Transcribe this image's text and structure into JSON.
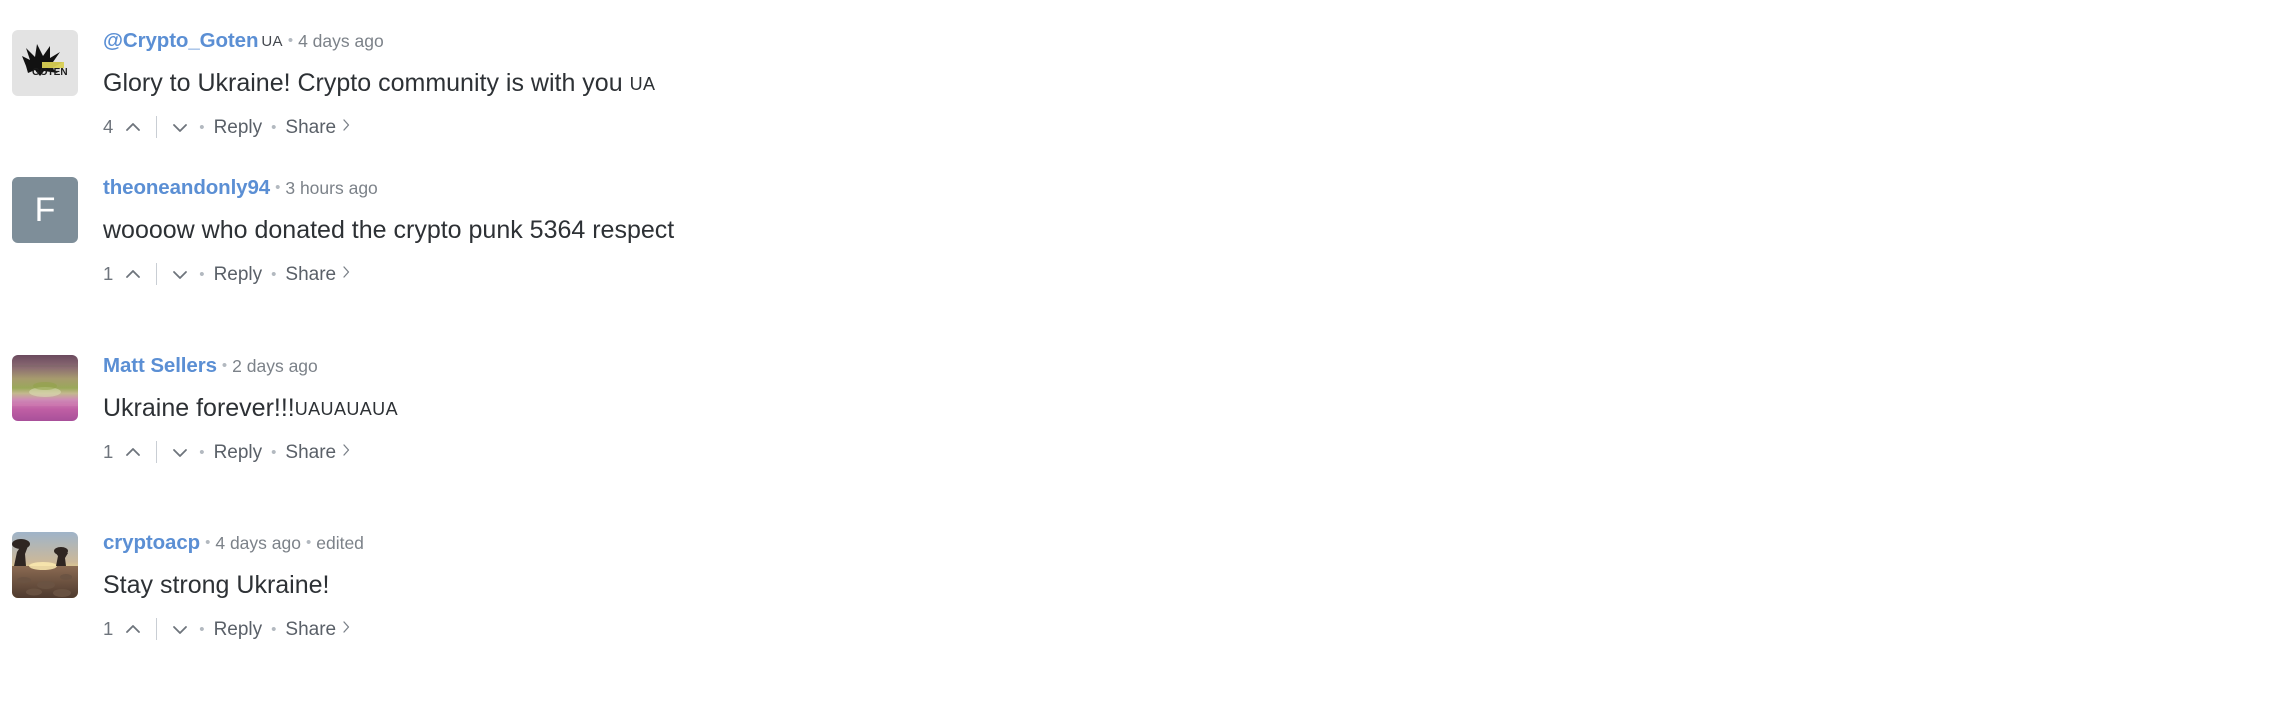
{
  "thread": {
    "comments": [
      {
        "author": "@Crypto_Goten",
        "author_flag": "UA",
        "separator": "•",
        "time": "4 days ago",
        "edited": "",
        "text": "Glory to Ukraine! Crypto community is with you ",
        "text_flags": "UA",
        "votes": "4",
        "reply_label": "Reply",
        "share_label": "Share",
        "share_chevron": "›",
        "avatar": {
          "type": "image",
          "kind": "goten-logo",
          "background": "#e3e3e3",
          "label": "GOTEN"
        }
      },
      {
        "author": "theoneandonly94",
        "author_flag": "",
        "separator": "•",
        "time": "3 hours ago",
        "edited": "",
        "text": "woooow who donated the crypto punk 5364 respect",
        "text_flags": "",
        "votes": "1",
        "reply_label": "Reply",
        "share_label": "Share",
        "share_chevron": "›",
        "avatar": {
          "type": "letter",
          "letter": "F",
          "background": "#7e8e99"
        }
      },
      {
        "author": "Matt Sellers",
        "author_flag": "",
        "separator": "•",
        "time": "2 days ago",
        "edited": "",
        "text": "Ukraine forever!!!",
        "text_flags": "UAUAUAUA",
        "votes": "1",
        "reply_label": "Reply",
        "share_label": "Share",
        "share_chevron": "›",
        "avatar": {
          "type": "image",
          "kind": "purple-landscape",
          "background": "#b66aa0"
        }
      },
      {
        "author": "cryptoacp",
        "author_flag": "",
        "separator": "•",
        "time": "4 days ago",
        "edited": "edited",
        "text": "Stay strong Ukraine!",
        "text_flags": "",
        "votes": "1",
        "reply_label": "Reply",
        "share_label": "Share",
        "share_chevron": "›",
        "avatar": {
          "type": "image",
          "kind": "sunset-trees",
          "background": "#c9a06a"
        }
      }
    ]
  },
  "colors": {
    "author_link": "#5b8fd4",
    "body_text": "#2d3135",
    "muted": "#7c8289",
    "action": "#5a6068",
    "divider": "#c9ced4"
  }
}
